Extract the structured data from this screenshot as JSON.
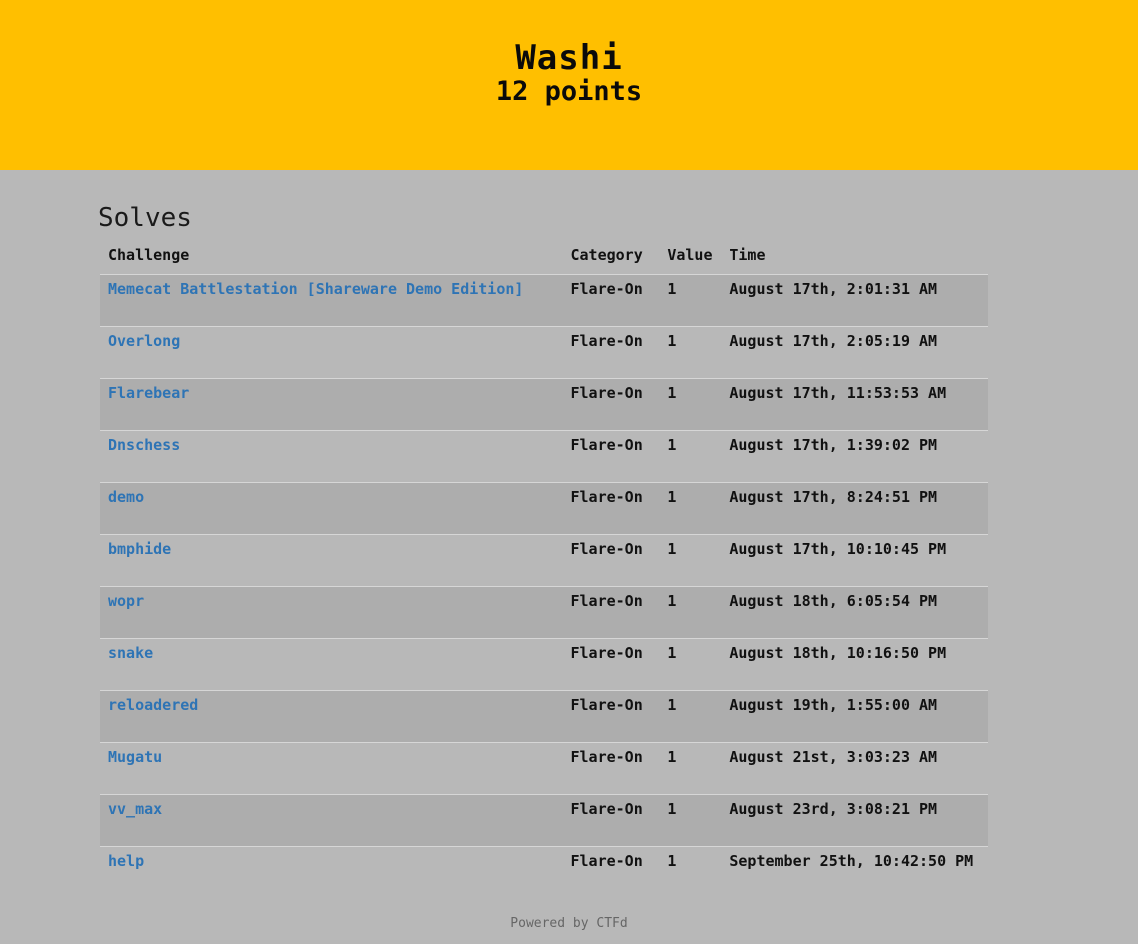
{
  "hero": {
    "name": "Washi",
    "points": "12 points"
  },
  "solves": {
    "title": "Solves",
    "headers": [
      "Challenge",
      "Category",
      "Value",
      "Time"
    ],
    "rows": [
      {
        "challenge": "Memecat Battlestation [Shareware Demo Edition]",
        "category": "Flare-On",
        "value": "1",
        "time": "August 17th, 2:01:31 AM"
      },
      {
        "challenge": "Overlong",
        "category": "Flare-On",
        "value": "1",
        "time": "August 17th, 2:05:19 AM"
      },
      {
        "challenge": "Flarebear",
        "category": "Flare-On",
        "value": "1",
        "time": "August 17th, 11:53:53 AM"
      },
      {
        "challenge": "Dnschess",
        "category": "Flare-On",
        "value": "1",
        "time": "August 17th, 1:39:02 PM"
      },
      {
        "challenge": "demo",
        "category": "Flare-On",
        "value": "1",
        "time": "August 17th, 8:24:51 PM"
      },
      {
        "challenge": "bmphide",
        "category": "Flare-On",
        "value": "1",
        "time": "August 17th, 10:10:45 PM"
      },
      {
        "challenge": "wopr",
        "category": "Flare-On",
        "value": "1",
        "time": "August 18th, 6:05:54 PM"
      },
      {
        "challenge": "snake",
        "category": "Flare-On",
        "value": "1",
        "time": "August 18th, 10:16:50 PM"
      },
      {
        "challenge": "reloadered",
        "category": "Flare-On",
        "value": "1",
        "time": "August 19th, 1:55:00 AM"
      },
      {
        "challenge": "Mugatu",
        "category": "Flare-On",
        "value": "1",
        "time": "August 21st, 3:03:23 AM"
      },
      {
        "challenge": "vv_max",
        "category": "Flare-On",
        "value": "1",
        "time": "August 23rd, 3:08:21 PM"
      },
      {
        "challenge": "help",
        "category": "Flare-On",
        "value": "1",
        "time": "September 25th, 10:42:50 PM"
      }
    ]
  },
  "footer": {
    "text": "Powered by CTFd"
  },
  "colors": {
    "hero_bg": "#ffbf00",
    "page_bg": "#b8b8b8",
    "link": "#2e74b5"
  }
}
